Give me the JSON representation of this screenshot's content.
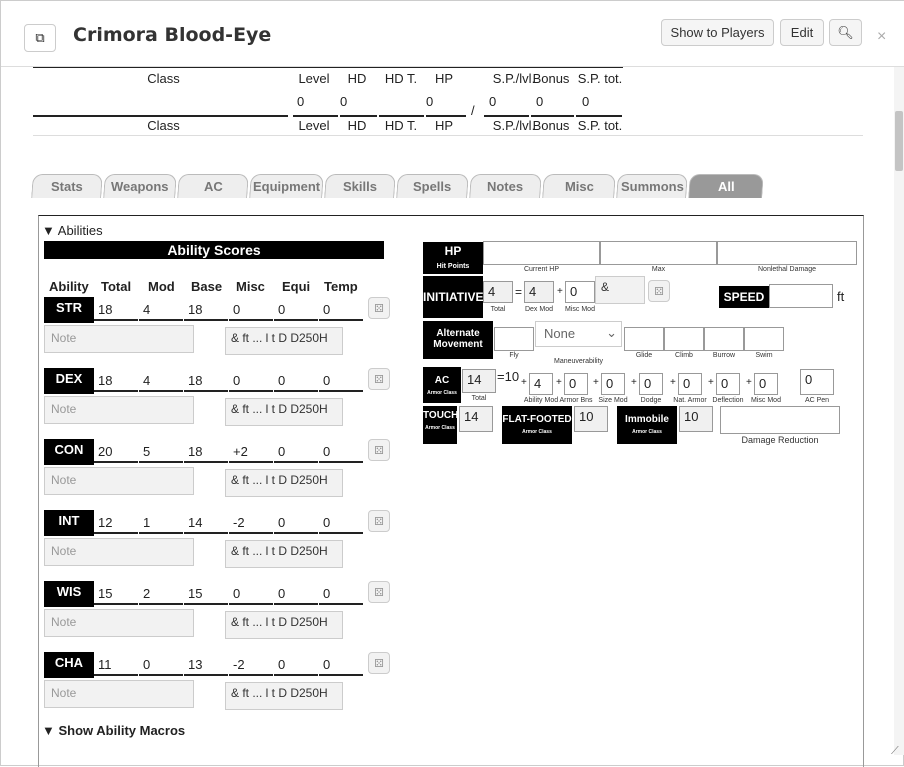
{
  "header": {
    "title": "Crimora Blood-Eye",
    "show_label": "Show to Players",
    "edit_label": "Edit",
    "close": "×"
  },
  "classrow": {
    "class": "Class",
    "level": "Level",
    "hd": "HD",
    "hdt": "HD T.",
    "hp": "HP",
    "sp": "S.P./lvl.",
    "bonus": "Bonus",
    "sptot": "S.P. tot.",
    "slash": "/",
    "v_level": "0",
    "v_hd": "0",
    "v_hp": "0",
    "v_sp": "0",
    "v_bonus": "0",
    "v_sptot": "0"
  },
  "tabs": [
    "Stats",
    "Weapons",
    "AC",
    "Equipment",
    "Skills",
    "Spells",
    "Notes",
    "Misc",
    "Summons",
    "All"
  ],
  "abilities": {
    "toggle": "▼",
    "heading": "Abilities",
    "title": "Ability Scores",
    "cols": [
      "Ability",
      "Total",
      "Mod",
      "Base",
      "Misc",
      "Equi",
      "Temp"
    ],
    "note": "Note",
    "amp": "&\nft ... l t D D250H",
    "rows": [
      {
        "name": "STR",
        "total": "18",
        "mod": "4",
        "base": "18",
        "misc": "0",
        "equi": "0",
        "temp": "0"
      },
      {
        "name": "DEX",
        "total": "18",
        "mod": "4",
        "base": "18",
        "misc": "0",
        "equi": "0",
        "temp": "0"
      },
      {
        "name": "CON",
        "total": "20",
        "mod": "5",
        "base": "18",
        "misc": "+2",
        "equi": "0",
        "temp": "0"
      },
      {
        "name": "INT",
        "total": "12",
        "mod": "1",
        "base": "14",
        "misc": "-2",
        "equi": "0",
        "temp": "0"
      },
      {
        "name": "WIS",
        "total": "15",
        "mod": "2",
        "base": "15",
        "misc": "0",
        "equi": "0",
        "temp": "0"
      },
      {
        "name": "CHA",
        "total": "11",
        "mod": "0",
        "base": "13",
        "misc": "-2",
        "equi": "0",
        "temp": "0"
      }
    ],
    "macros": "Show Ability Macros"
  },
  "combat": {
    "hp": "HP",
    "hp_sub": "Hit Points",
    "hp_current": "Current HP",
    "hp_max": "Max",
    "hp_nonlethal": "Nonlethal Damage",
    "init": "INITIATIVE",
    "init_total": "4",
    "init_dex": "4",
    "init_misc": "0",
    "lbl_total": "Total",
    "lbl_dexmod": "Dex Mod",
    "lbl_miscmod": "Misc Mod",
    "init_amp": "&",
    "speed": "SPEED",
    "speed_unit": "ft",
    "alt": "Alternate Movement",
    "fly": "Fly",
    "maneuver": "None",
    "maneuver_lbl": "Maneuverability",
    "glide": "Glide",
    "climb": "Climb",
    "burrow": "Burrow",
    "swim": "Swim",
    "ac": "AC",
    "ac_sub": "Armor Class",
    "ac_total": "14",
    "ac_base": "=10",
    "ac_abil": "4",
    "ac_armor": "0",
    "ac_size": "0",
    "ac_dodge": "0",
    "ac_nat": "0",
    "ac_defl": "0",
    "ac_misc": "0",
    "ac_pen": "0",
    "lbl_abil": "Ability Mod",
    "lbl_armor": "Armor Bns",
    "lbl_size": "Size Mod",
    "lbl_dodge": "Dodge",
    "lbl_nat": "Nat. Armor",
    "lbl_defl": "Deflection",
    "lbl_misc2": "Misc Mod",
    "lbl_pen": "AC Pen",
    "touch": "TOUCH",
    "touch_val": "14",
    "ff": "FLAT-FOOTED",
    "ff_val": "10",
    "imm": "Immobile",
    "imm_val": "10",
    "dr": "Damage Reduction"
  }
}
